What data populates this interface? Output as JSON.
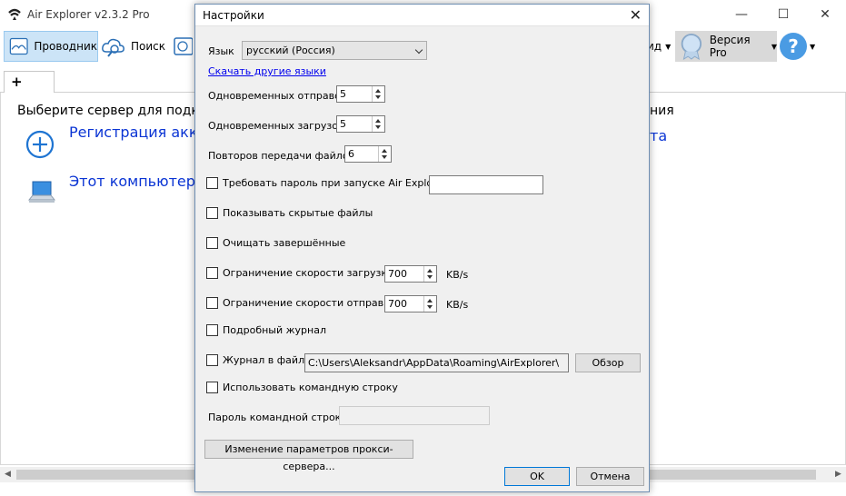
{
  "app": {
    "title": "Air Explorer v2.3.2 Pro",
    "window_controls": {
      "minimize": "—",
      "maximize": "☐",
      "close": "✕"
    }
  },
  "toolbar": {
    "explorer_label": "Проводник",
    "search_label": "Поиск",
    "view_label": "ид",
    "pro_label": "Версия Pro",
    "help_symbol": "?"
  },
  "tabs": {
    "add_label": "+"
  },
  "content": {
    "hint_left": "Выберите сервер для подклю",
    "hint_right": "ния",
    "register_label": "Регистрация аккау",
    "register_suffix": "та",
    "this_computer_label": "Этот компьютер"
  },
  "dialog": {
    "title": "Настройки",
    "close_symbol": "✕",
    "language": {
      "label": "Язык",
      "value": "русский (Россия)",
      "download_link": "Скачать другие языки"
    },
    "concurrent_uploads": {
      "label": "Одновременных отправок",
      "value": "5"
    },
    "concurrent_downloads": {
      "label": "Одновременных загрузок",
      "value": "5"
    },
    "retries": {
      "label": "Повторов передачи файлов",
      "value": "6"
    },
    "require_password": {
      "label": "Требовать пароль при запуске Air Explorer",
      "checked": false,
      "value": ""
    },
    "show_hidden": {
      "label": "Показывать скрытые файлы",
      "checked": false
    },
    "clear_completed": {
      "label": "Очищать завершённые",
      "checked": false
    },
    "download_limit": {
      "label": "Ограничение скорости загрузки",
      "checked": false,
      "value": "700",
      "unit": "KB/s"
    },
    "upload_limit": {
      "label": "Ограничение скорости отправки",
      "checked": false,
      "value": "700",
      "unit": "KB/s"
    },
    "verbose_log": {
      "label": "Подробный журнал",
      "checked": false
    },
    "log_to_file": {
      "label": "Журнал в файл",
      "checked": false,
      "path": "C:\\Users\\Aleksandr\\AppData\\Roaming\\AirExplorer\\",
      "browse_label": "Обзор"
    },
    "command_line": {
      "label": "Использовать командную строку",
      "checked": false
    },
    "cmd_password": {
      "label": "Пароль командной строки",
      "value": ""
    },
    "proxy_button": "Изменение параметров прокси-сервера...",
    "ok_button": "OK",
    "cancel_button": "Отмена"
  },
  "colors": {
    "link": "#0b35d4",
    "selected_tool_bg": "#cce4f7",
    "dialog_bg": "#f0f0f0",
    "accent": "#0078d7"
  }
}
